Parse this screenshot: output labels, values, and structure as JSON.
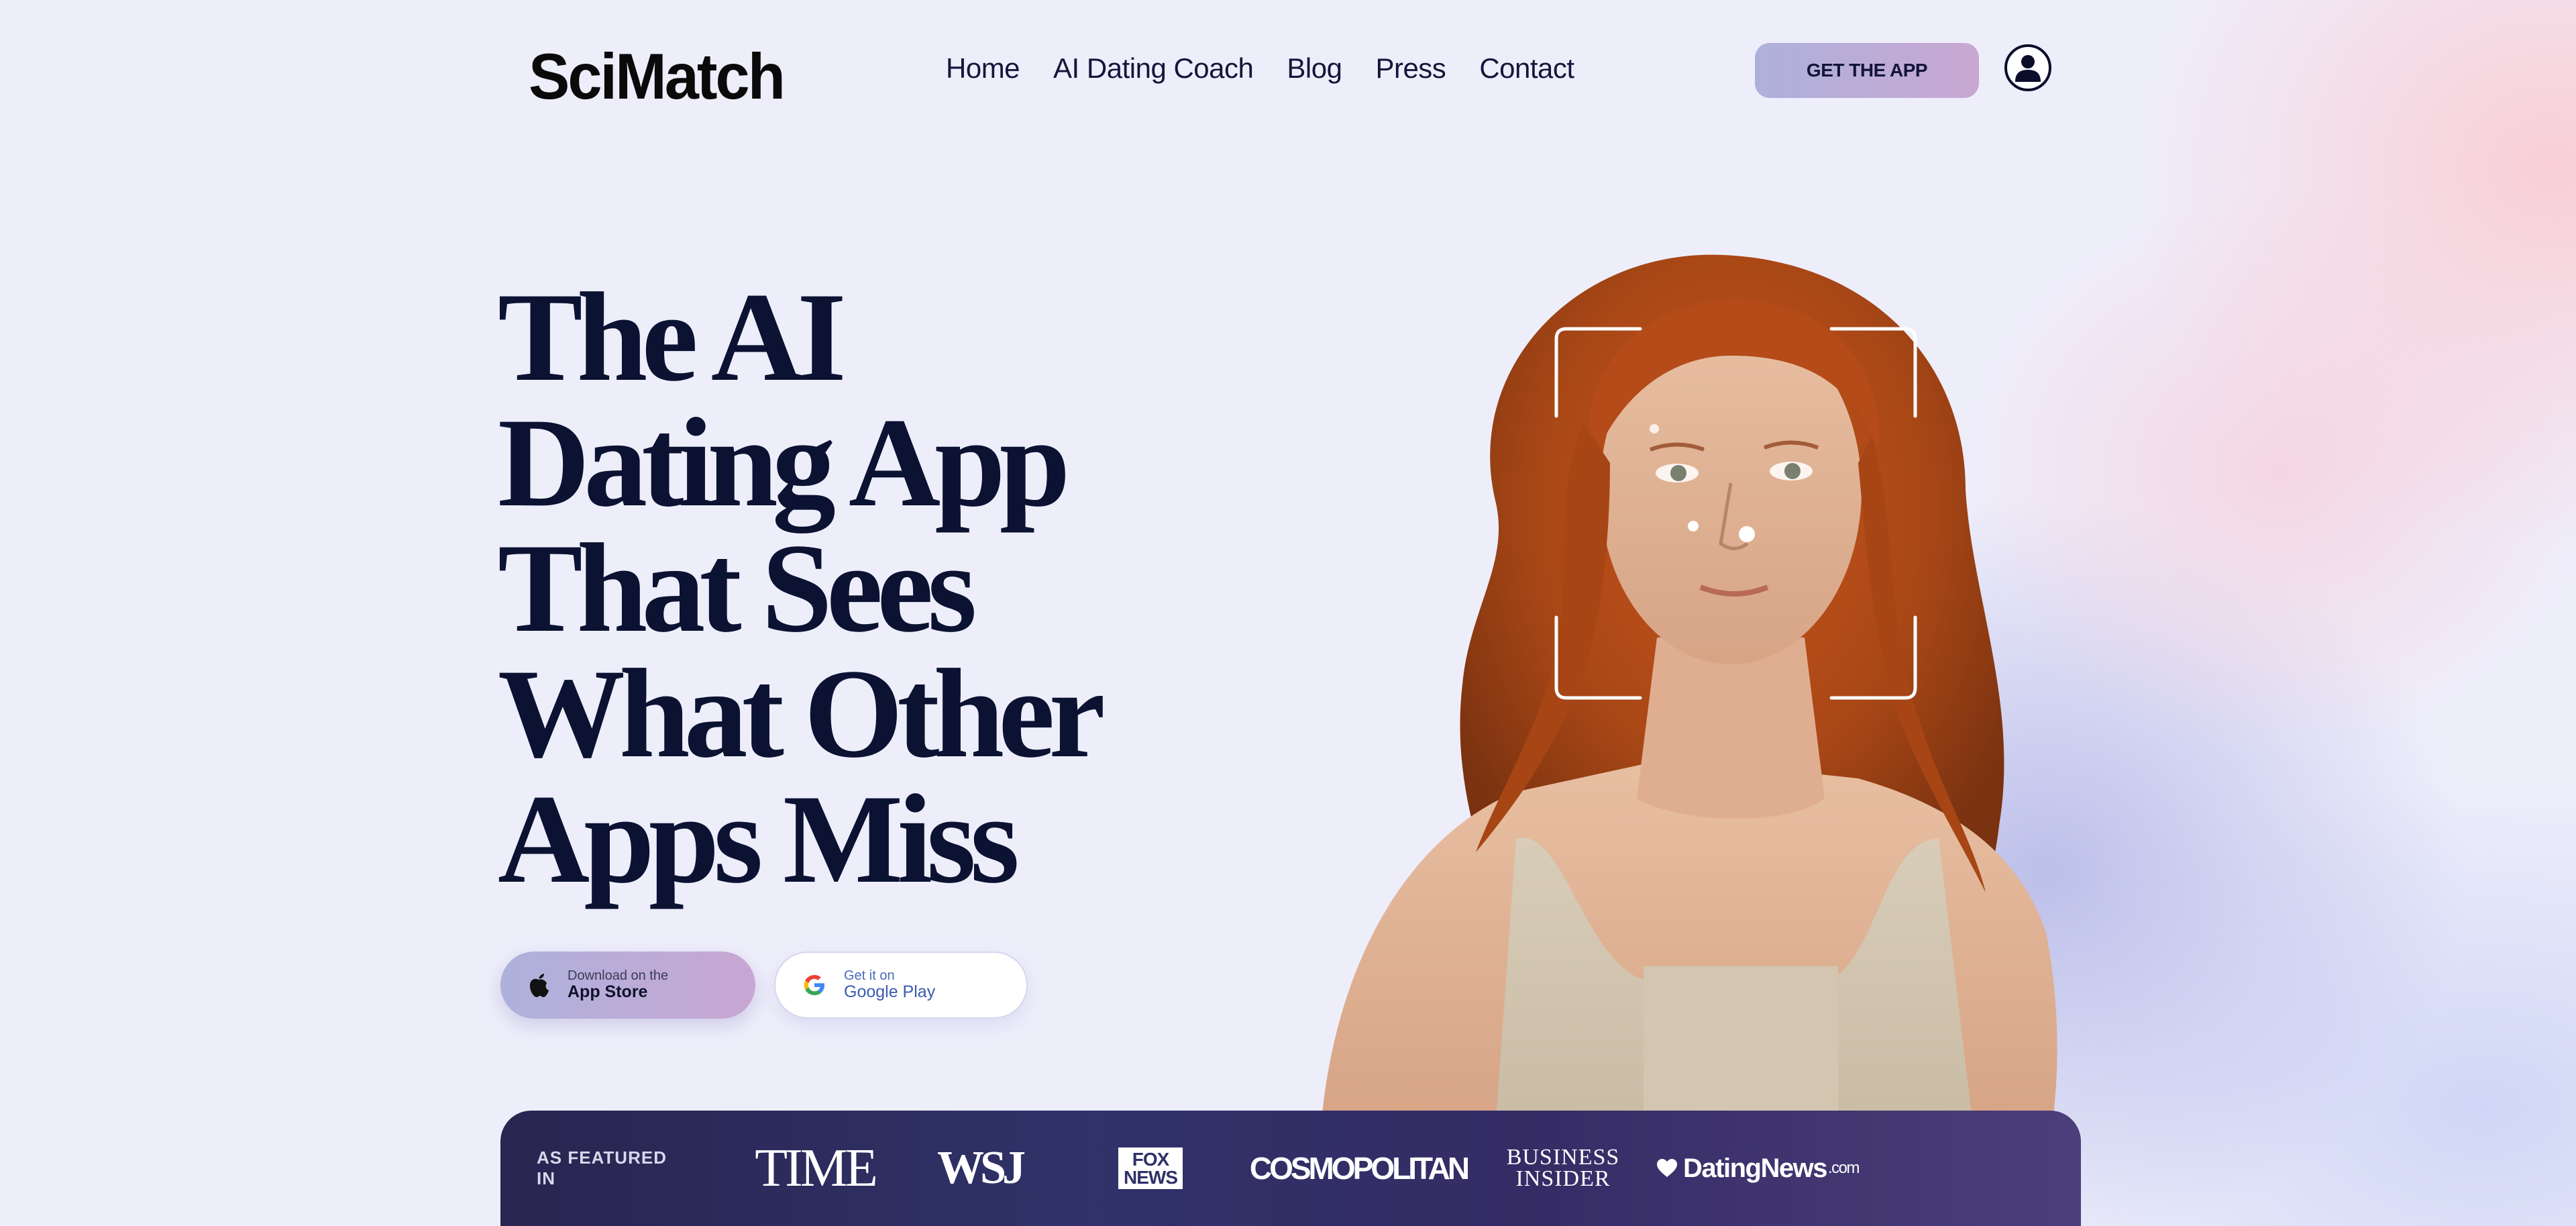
{
  "brand": {
    "name": "SciMatch"
  },
  "nav": {
    "items": [
      {
        "label": "Home"
      },
      {
        "label": "AI Dating Coach"
      },
      {
        "label": "Blog"
      },
      {
        "label": "Press"
      },
      {
        "label": "Contact"
      }
    ],
    "cta_label": "GET THE APP",
    "user_icon": "user-icon"
  },
  "hero": {
    "headline_lines": [
      "The AI",
      "Dating App",
      "That Sees",
      "What Other",
      "Apps Miss"
    ],
    "photo_icon": "portrait-photo",
    "app_store": {
      "small": "Download on the",
      "big": "App Store",
      "icon": "apple-icon"
    },
    "google_play": {
      "small": "Get it on",
      "big": "Google Play",
      "icon": "google-icon"
    }
  },
  "featured": {
    "label": "AS FEATURED IN",
    "logos": {
      "time": "TIME",
      "wsj": "WSJ",
      "fox_top": "FOX",
      "fox_bottom": "NEWS",
      "cosmo": "COSMOPOLITAN",
      "bi_top": "BUSINESS",
      "bi_bottom": "INSIDER",
      "dn_main": "DatingNews",
      "dn_suffix": ".com"
    }
  },
  "colors": {
    "headline": "#0b1232",
    "cta_gradient_start": "#aeb0dc",
    "cta_gradient_end": "#c8a8d2",
    "featured_bar": "#2f3268"
  }
}
